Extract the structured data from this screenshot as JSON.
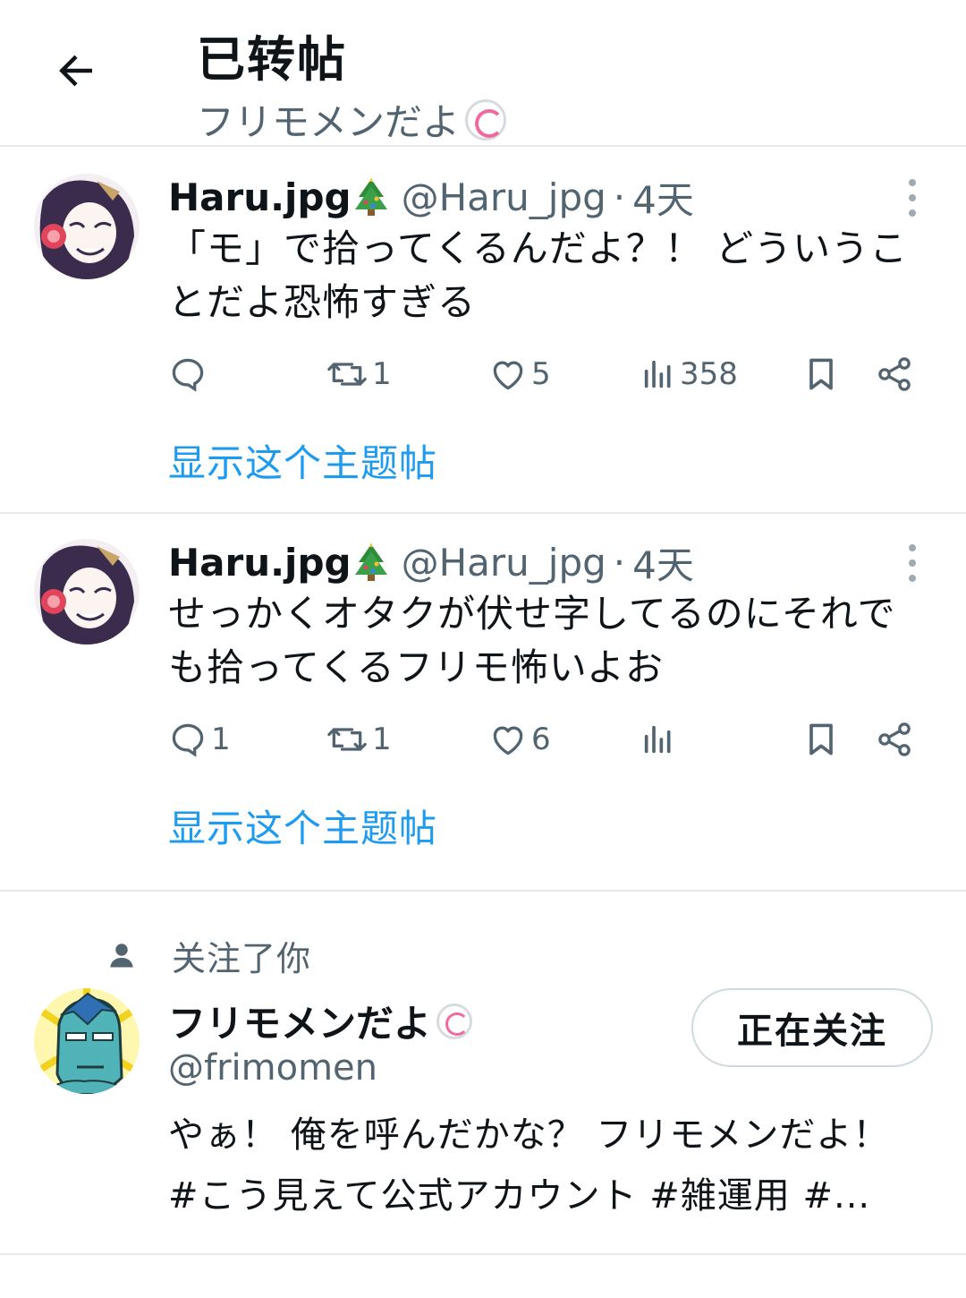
{
  "header": {
    "title": "已转帖",
    "subtitle": "フリモメンだよ",
    "subtitle_emoji": "naruto-emoji"
  },
  "tweets": [
    {
      "display_name": "Haru.jpg",
      "name_emoji": "christmas-tree-emoji",
      "handle": "@Haru_jpg",
      "separator": "·",
      "time": "4天",
      "text_line1": "「モ」で拾ってくるんだよ？！ どういうこ",
      "text_line2": "とだよ恐怖すぎる",
      "reply_count": "",
      "retweet_count": "1",
      "like_count": "5",
      "view_count": "358",
      "show_thread": "显示这个主题帖"
    },
    {
      "display_name": "Haru.jpg",
      "name_emoji": "christmas-tree-emoji",
      "handle": "@Haru_jpg",
      "separator": "·",
      "time": "4天",
      "text_line1": "せっかくオタクが伏せ字してるのにそれで",
      "text_line2": "も拾ってくるフリモ怖いよお",
      "reply_count": "1",
      "retweet_count": "1",
      "like_count": "6",
      "view_count": "",
      "show_thread": "显示这个主题帖"
    }
  ],
  "follow_card": {
    "label": "关注了你",
    "display_name": "フリモメンだよ",
    "name_emoji": "naruto-emoji",
    "handle": "@frimomen",
    "button_label": "正在关注",
    "bio_line1": "やぁ！ 俺を呼んだかな？ フリモメンだよ！",
    "bio_line2": "#こう見えて公式アカウント #雑運用 #..."
  },
  "colors": {
    "text_primary": "#0f1419",
    "text_secondary": "#536471",
    "link": "#1d9bf0",
    "divider": "#e6e9ec"
  }
}
